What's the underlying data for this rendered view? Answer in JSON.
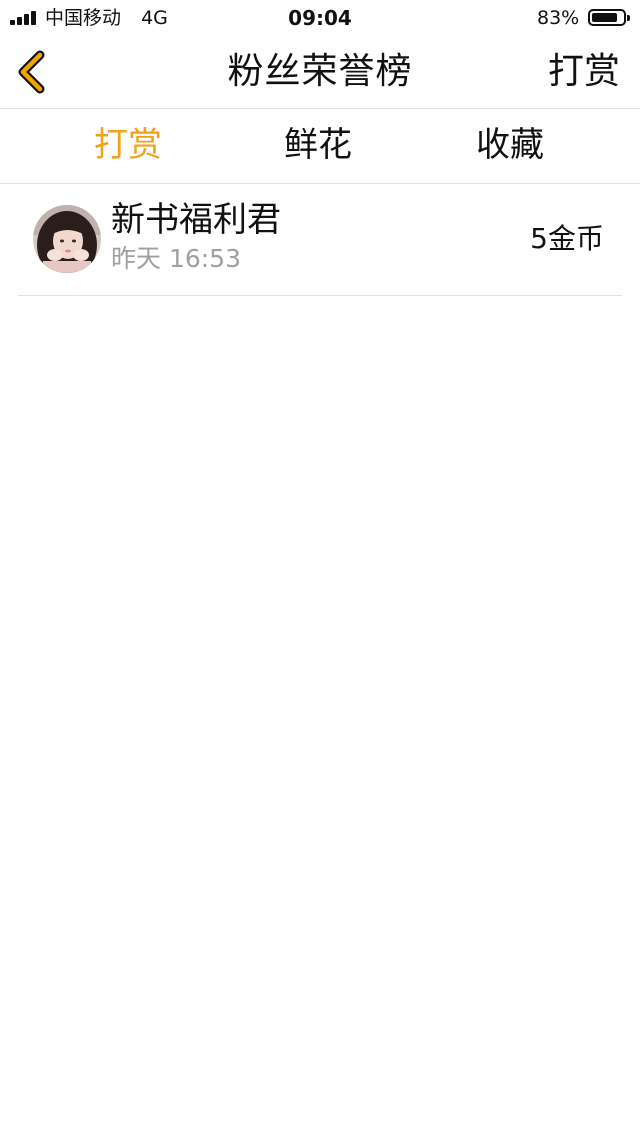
{
  "status_bar": {
    "carrier": "中国移动",
    "network": "4G",
    "time": "09:04",
    "battery_percent": "83%",
    "battery_level": 0.83
  },
  "nav": {
    "title": "粉丝荣誉榜",
    "action_label": "打赏",
    "back_icon": "chevron-left-icon",
    "back_icon_color": "#f2a500"
  },
  "tabs": [
    {
      "label": "打赏",
      "active": true
    },
    {
      "label": "鲜花",
      "active": false
    },
    {
      "label": "收藏",
      "active": false
    }
  ],
  "colors": {
    "accent": "#f2a11b",
    "text": "#111111",
    "secondary_text": "#a0a0a0",
    "divider": "#e2e2e2"
  },
  "fans": [
    {
      "name": "新书福利君",
      "time": "昨天 16:53",
      "amount": "5金币"
    }
  ]
}
